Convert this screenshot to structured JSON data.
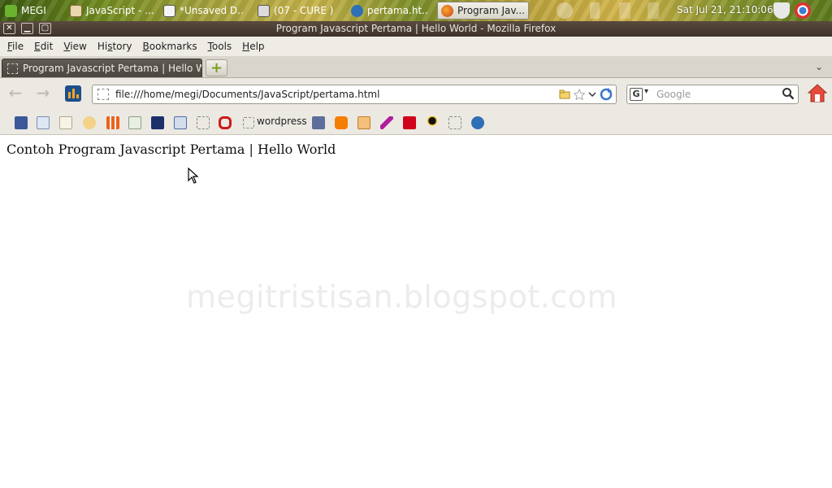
{
  "taskbar": {
    "items": [
      {
        "label": "MEGI"
      },
      {
        "label": "JavaScript - ..."
      },
      {
        "label": "*Unsaved D..."
      },
      {
        "label": "(07 - CURE )"
      },
      {
        "label": "pertama.ht..."
      },
      {
        "label": "Program Jav..."
      }
    ],
    "clock": "Sat Jul 21, 21:10:06"
  },
  "window": {
    "title": "Program Javascript Pertama | Hello World - Mozilla Firefox",
    "close": "✕",
    "minimize": "▁",
    "maximize": "▢"
  },
  "menu": {
    "items": [
      {
        "key": "F",
        "rest": "ile"
      },
      {
        "key": "E",
        "rest": "dit"
      },
      {
        "key": "V",
        "rest": "iew"
      },
      {
        "key": "",
        "label_full": "History",
        "pre": "Hi",
        "ukey": "s",
        "post": "tory"
      },
      {
        "key": "B",
        "rest": "ookmarks"
      },
      {
        "key": "T",
        "rest": "ools"
      },
      {
        "key": "H",
        "rest": "elp"
      }
    ]
  },
  "tabs": {
    "active_label": "Program Javascript Pertama | Hello Wo...",
    "new_tab": "+",
    "list_all": "⌄"
  },
  "nav": {
    "back": "←",
    "forward": "→",
    "url": "file:///home/megi/Documents/JavaScript/pertama.html",
    "search_placeholder": "Google",
    "search_engine": "G"
  },
  "bookmarks": {
    "wordpress": "wordpress"
  },
  "page": {
    "heading": "Contoh Program Javascript Pertama | Hello World",
    "watermark": "megitristisan.blogspot.com"
  },
  "colors": {
    "titlebar": "#3d322b",
    "chrome": "#ece9e3",
    "tab_active": "#4a4640",
    "facebook": "#3b5998",
    "blogger": "#f57d00",
    "wp": "#d0021b",
    "opera": "#cc1919"
  }
}
